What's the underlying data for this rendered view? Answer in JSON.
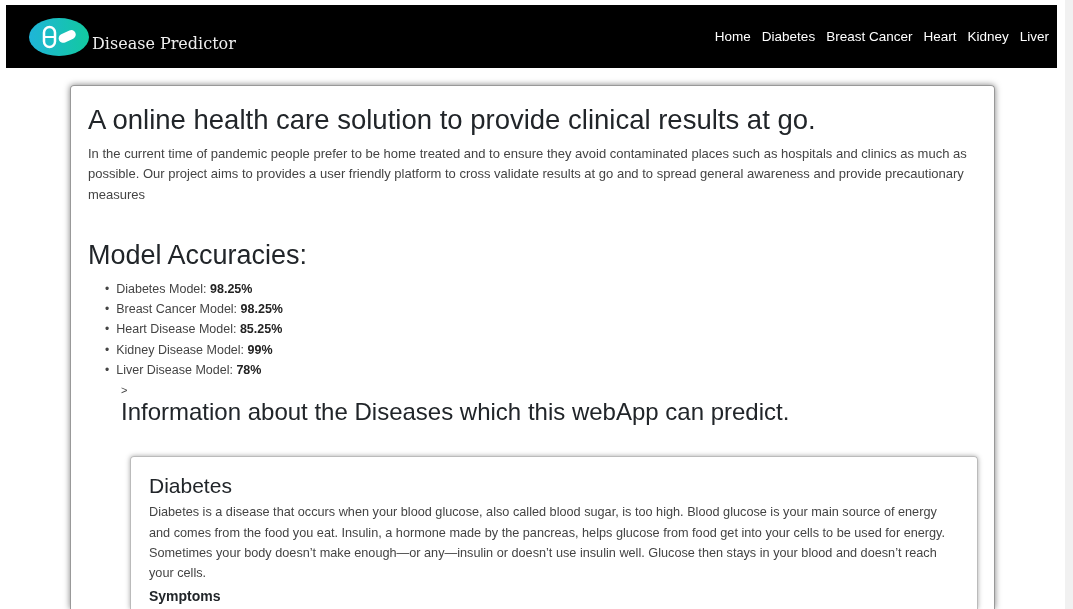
{
  "navbar": {
    "brand": "Disease Predictor",
    "links": [
      {
        "label": "Home"
      },
      {
        "label": "Diabetes"
      },
      {
        "label": "Breast Cancer"
      },
      {
        "label": "Heart"
      },
      {
        "label": "Kidney"
      },
      {
        "label": "Liver"
      }
    ]
  },
  "intro": {
    "title": "A online health care solution to provide clinical results at go.",
    "text": "In the current time of pandemic people prefer to be home treated and to ensure they avoid contaminated places such as hospitals and clinics as much as possible. Our project aims to provides a user friendly platform to cross validate results at go and to spread general awareness and provide precautionary measures"
  },
  "accuracies": {
    "title": "Model Accuracies:",
    "items": [
      {
        "marker": "•",
        "text": "Diabetes Model: **98.25%**"
      },
      {
        "marker": "•",
        "text": "Breast Cancer Model: **98.25%**"
      },
      {
        "marker": "•",
        "text": "Heart Disease Model: **85.25%**"
      },
      {
        "marker": "•",
        "text": "Kidney Disease Model: **99%**"
      },
      {
        "marker": "•",
        "text": "Liver Disease Model: **78%**"
      }
    ]
  },
  "stray_mark": ">",
  "diseases_title": "Information about the Diseases which this webApp can predict.",
  "disease_card": {
    "title": "Diabetes",
    "text": "Diabetes is a disease that occurs when your blood glucose, also called blood sugar, is too high. Blood glucose is your main source of energy and comes from the food you eat. Insulin, a hormone made by the pancreas, helps glucose from food get into your cells to be used for energy. Sometimes your body doesn’t make enough—or any—insulin or doesn’t use insulin well. Glucose then stays in your blood and doesn’t reach your cells.",
    "subheading": "Symptoms"
  }
}
